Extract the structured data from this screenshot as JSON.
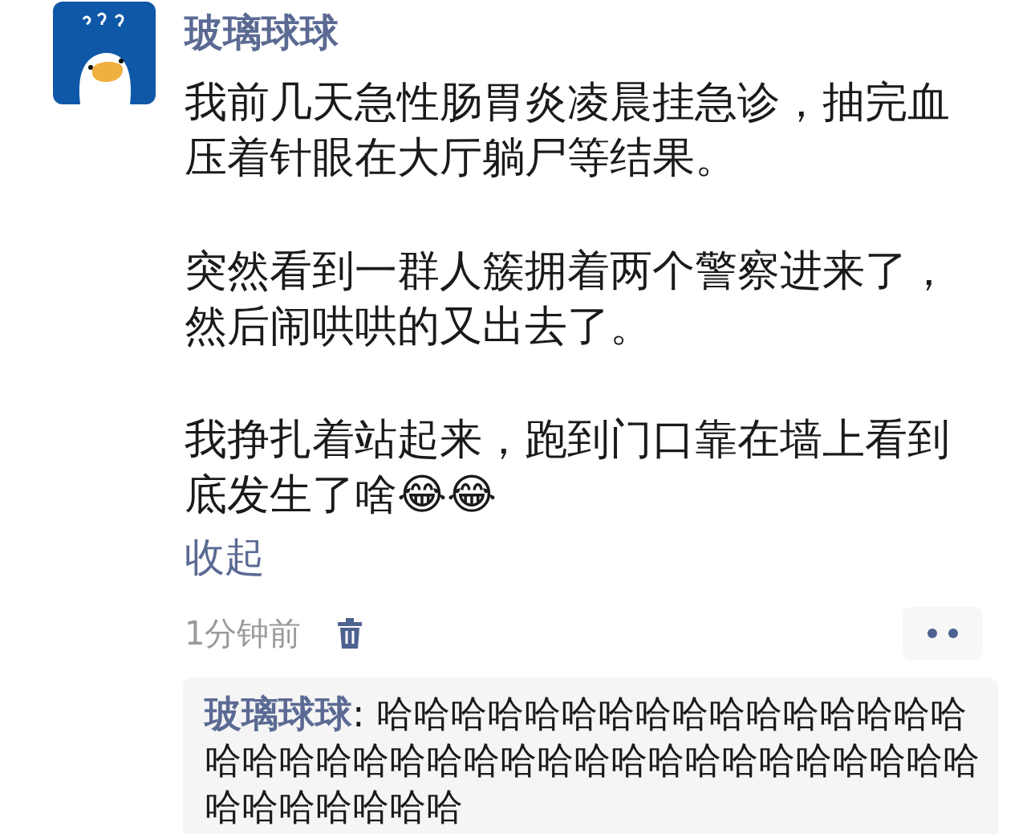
{
  "comment": {
    "author": "玻璃球球",
    "paragraphs": [
      "我前几天急性肠胃炎凌晨挂急诊，抽完血压着针眼在大厅躺尸等结果。",
      "突然看到一群人簇拥着两个警察进来了，然后闹哄哄的又出去了。",
      "我挣扎着站起来，跑到门口靠在墙上看到底发生了啥😂😂"
    ],
    "collapse_link": "收起",
    "time": "1分钟前"
  },
  "reply": {
    "author": "玻璃球球",
    "separator": ":",
    "text": "哈哈哈哈哈哈哈哈哈哈哈哈哈哈哈哈哈哈哈哈哈哈哈哈哈哈哈哈哈哈哈哈哈哈哈哈哈哈哈哈哈哈哈哈"
  }
}
